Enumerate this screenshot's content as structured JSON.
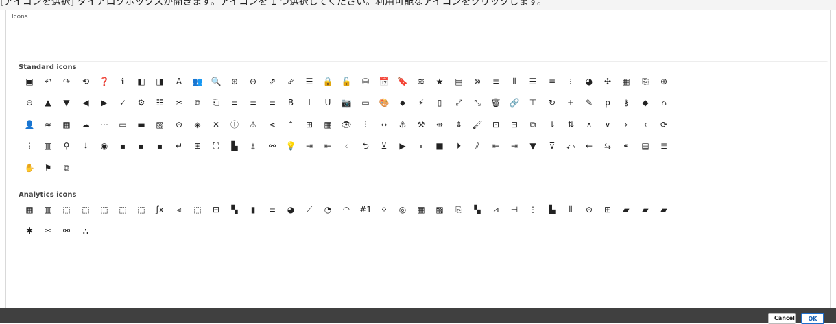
{
  "page": {
    "top_text": "[アイコンを選択] ダイアログボックスが開きます。アイコンを 1 つ選択してください。利用可能なアイコンをクリックします。"
  },
  "dialog": {
    "title": "Icons",
    "sections": [
      {
        "heading": "Standard icons",
        "icons": [
          {
            "name": "image-icon",
            "glyph": "▣"
          },
          {
            "name": "undo-icon",
            "glyph": "↶"
          },
          {
            "name": "redo-icon",
            "glyph": "↷"
          },
          {
            "name": "history-icon",
            "glyph": "⟲"
          },
          {
            "name": "help-icon",
            "glyph": "❓"
          },
          {
            "name": "info-icon",
            "glyph": "ℹ"
          },
          {
            "name": "panel-left-icon",
            "glyph": "◧"
          },
          {
            "name": "panel-right-icon",
            "glyph": "◨"
          },
          {
            "name": "text-icon",
            "glyph": "A"
          },
          {
            "name": "users-icon",
            "glyph": "👥"
          },
          {
            "name": "search-icon",
            "glyph": "🔍"
          },
          {
            "name": "zoom-in-icon",
            "glyph": "⊕"
          },
          {
            "name": "zoom-out-icon",
            "glyph": "⊖"
          },
          {
            "name": "export-icon",
            "glyph": "⇗"
          },
          {
            "name": "import-icon",
            "glyph": "⇙"
          },
          {
            "name": "document-icon",
            "glyph": "☰"
          },
          {
            "name": "lock-icon",
            "glyph": "🔒"
          },
          {
            "name": "unlock-icon",
            "glyph": "🔓"
          },
          {
            "name": "database-icon",
            "glyph": "⛁"
          },
          {
            "name": "calendar-icon",
            "glyph": "📅"
          },
          {
            "name": "bookmark-icon",
            "glyph": "🔖"
          },
          {
            "name": "stack-icon",
            "glyph": "≋"
          },
          {
            "name": "star-icon",
            "glyph": "★"
          },
          {
            "name": "sheet-icon",
            "glyph": "▤"
          },
          {
            "name": "close-circle-icon",
            "glyph": "⊗"
          },
          {
            "name": "menu-icon",
            "glyph": "≡"
          },
          {
            "name": "columns-icon",
            "glyph": "⦀"
          },
          {
            "name": "align-center-icon",
            "glyph": "☰"
          },
          {
            "name": "align-justify-icon",
            "glyph": "≣"
          },
          {
            "name": "bullet-list-icon",
            "glyph": "⁝"
          },
          {
            "name": "pie-chart-icon",
            "glyph": "◕"
          },
          {
            "name": "puzzle-icon",
            "glyph": "✣"
          },
          {
            "name": "table-icon",
            "glyph": "▦"
          },
          {
            "name": "file-export-icon",
            "glyph": "⎘"
          },
          {
            "name": "add-circle-icon",
            "glyph": "⊕"
          },
          {
            "name": "remove-circle-icon",
            "glyph": "⊖"
          },
          {
            "name": "triangle-up-icon",
            "glyph": "▲"
          },
          {
            "name": "triangle-down-icon",
            "glyph": "▼"
          },
          {
            "name": "triangle-left-icon",
            "glyph": "◀"
          },
          {
            "name": "triangle-right-icon",
            "glyph": "▶"
          },
          {
            "name": "tick-icon",
            "glyph": "✓"
          },
          {
            "name": "cog-icon",
            "glyph": "⚙"
          },
          {
            "name": "list-icon",
            "glyph": "☷"
          },
          {
            "name": "cut-icon",
            "glyph": "✂"
          },
          {
            "name": "copy-icon",
            "glyph": "⧉"
          },
          {
            "name": "paste-icon",
            "glyph": "⎗"
          },
          {
            "name": "align-left-icon",
            "glyph": "≡"
          },
          {
            "name": "align-center-text-icon",
            "glyph": "≡"
          },
          {
            "name": "align-right-icon",
            "glyph": "≡"
          },
          {
            "name": "bold-icon",
            "glyph": "B"
          },
          {
            "name": "italic-icon",
            "glyph": "I"
          },
          {
            "name": "underline-icon",
            "glyph": "U"
          },
          {
            "name": "camera-icon",
            "glyph": "📷"
          },
          {
            "name": "presentation-icon",
            "glyph": "▭"
          },
          {
            "name": "palette-icon",
            "glyph": "🎨"
          },
          {
            "name": "shapes-icon",
            "glyph": "⬥"
          },
          {
            "name": "magic-wand-icon",
            "glyph": "⚡"
          },
          {
            "name": "blank-document-icon",
            "glyph": "▯"
          },
          {
            "name": "expand-icon",
            "glyph": "⤢"
          },
          {
            "name": "collapse-icon",
            "glyph": "⤡"
          },
          {
            "name": "trash-icon",
            "glyph": "🗑"
          },
          {
            "name": "link-icon",
            "glyph": "🔗"
          },
          {
            "name": "filter-table-icon",
            "glyph": "⊤"
          },
          {
            "name": "reload-icon",
            "glyph": "↻"
          },
          {
            "name": "plus-icon",
            "glyph": "+"
          },
          {
            "name": "edit-icon",
            "glyph": "✎"
          },
          {
            "name": "lasso-icon",
            "glyph": "ρ"
          },
          {
            "name": "key-icon",
            "glyph": "⚷"
          },
          {
            "name": "cube-icon",
            "glyph": "◆"
          },
          {
            "name": "home-icon",
            "glyph": "⌂"
          },
          {
            "name": "user-icon",
            "glyph": "👤"
          },
          {
            "name": "wave-icon",
            "glyph": "≈"
          },
          {
            "name": "grid-icon",
            "glyph": "▦"
          },
          {
            "name": "cloud-icon",
            "glyph": "☁"
          },
          {
            "name": "more-icon",
            "glyph": "⋯"
          },
          {
            "name": "folder-icon",
            "glyph": "▭"
          },
          {
            "name": "minimize-icon",
            "glyph": "▬"
          },
          {
            "name": "image-frame-icon",
            "glyph": "▧"
          },
          {
            "name": "play-circle-icon",
            "glyph": "⊙"
          },
          {
            "name": "tag-icon",
            "glyph": "◈"
          },
          {
            "name": "close-icon",
            "glyph": "✕"
          },
          {
            "name": "info-circle-icon",
            "glyph": "ⓘ"
          },
          {
            "name": "warning-icon",
            "glyph": "⚠"
          },
          {
            "name": "share-icon",
            "glyph": "⋖"
          },
          {
            "name": "double-chevron-up-icon",
            "glyph": "⌃"
          },
          {
            "name": "object-icon",
            "glyph": "⊞"
          },
          {
            "name": "table-grid-icon",
            "glyph": "▦"
          },
          {
            "name": "view-icon",
            "glyph": "👁"
          },
          {
            "name": "sliders-icon",
            "glyph": "⫶"
          },
          {
            "name": "code-icon",
            "glyph": "‹›"
          },
          {
            "name": "drop-icon",
            "glyph": "⚓"
          },
          {
            "name": "tools-icon",
            "glyph": "⚒"
          },
          {
            "name": "split-icon",
            "glyph": "⇹"
          },
          {
            "name": "sort-icon",
            "glyph": "⇕"
          },
          {
            "name": "paint-icon",
            "glyph": "🖌"
          },
          {
            "name": "screen-icon",
            "glyph": "⊡"
          },
          {
            "name": "box-icon",
            "glyph": "⊟"
          },
          {
            "name": "duplicate-icon",
            "glyph": "⧉"
          },
          {
            "name": "sort-ascending-icon",
            "glyph": "⇂"
          },
          {
            "name": "sort-descending-icon",
            "glyph": "⇅"
          },
          {
            "name": "chevron-up-icon",
            "glyph": "∧"
          },
          {
            "name": "chevron-down-icon",
            "glyph": "∨"
          },
          {
            "name": "chevron-right-icon",
            "glyph": "›"
          },
          {
            "name": "chevron-left-icon",
            "glyph": "‹"
          },
          {
            "name": "sync-icon",
            "glyph": "⟳"
          },
          {
            "name": "drag-handle-icon",
            "glyph": "⁞"
          },
          {
            "name": "layout-icon",
            "glyph": "▥"
          },
          {
            "name": "pivot-icon",
            "glyph": "⚲"
          },
          {
            "name": "download-icon",
            "glyph": "⤓"
          },
          {
            "name": "bot-icon",
            "glyph": "◉"
          },
          {
            "name": "object-small-icon",
            "glyph": "▪"
          },
          {
            "name": "object-medium-icon",
            "glyph": "▪"
          },
          {
            "name": "object-large-icon",
            "glyph": "▪"
          },
          {
            "name": "enter-icon",
            "glyph": "↵"
          },
          {
            "name": "qr-icon",
            "glyph": "⊞"
          },
          {
            "name": "focus-icon",
            "glyph": "⛶"
          },
          {
            "name": "component-icon",
            "glyph": "▙"
          },
          {
            "name": "bell-icon",
            "glyph": "⍋"
          },
          {
            "name": "broken-link-icon",
            "glyph": "⚯"
          },
          {
            "name": "bulb-icon",
            "glyph": "💡"
          },
          {
            "name": "login-icon",
            "glyph": "⇥"
          },
          {
            "name": "logout-icon",
            "glyph": "⇤"
          },
          {
            "name": "back-icon",
            "glyph": "‹"
          },
          {
            "name": "return-icon",
            "glyph": "⮌"
          },
          {
            "name": "save-icon",
            "glyph": "⊻"
          },
          {
            "name": "play-icon",
            "glyph": "▶"
          },
          {
            "name": "pause-icon",
            "glyph": "⏸"
          },
          {
            "name": "stop-icon",
            "glyph": "■"
          },
          {
            "name": "step-icon",
            "glyph": "⏵"
          },
          {
            "name": "slash-icon",
            "glyph": "⫽"
          },
          {
            "name": "insert-left-icon",
            "glyph": "⇤"
          },
          {
            "name": "insert-right-icon",
            "glyph": "⇥"
          },
          {
            "name": "filter-icon",
            "glyph": "▼"
          },
          {
            "name": "clear-filter-icon",
            "glyph": "⊽"
          },
          {
            "name": "select-icon",
            "glyph": "⤺"
          },
          {
            "name": "arrow-left-icon",
            "glyph": "←"
          },
          {
            "name": "swap-icon",
            "glyph": "⇆"
          },
          {
            "name": "tree-icon",
            "glyph": "⚭"
          },
          {
            "name": "form-icon",
            "glyph": "▤"
          },
          {
            "name": "hamburger-icon",
            "glyph": "≣"
          },
          {
            "name": "hand-icon",
            "glyph": "✋"
          },
          {
            "name": "flag-icon",
            "glyph": "⚑"
          },
          {
            "name": "external-link-icon",
            "glyph": "⧉"
          }
        ]
      },
      {
        "heading": "Analytics icons",
        "icons": [
          {
            "name": "kpi-icon",
            "glyph": "▦"
          },
          {
            "name": "bar-kpi-icon",
            "glyph": "▥"
          },
          {
            "name": "clear-selection-icon",
            "glyph": "⬚"
          },
          {
            "name": "select-values-icon",
            "glyph": "⬚"
          },
          {
            "name": "lasso-select-icon",
            "glyph": "⬚"
          },
          {
            "name": "select-back-icon",
            "glyph": "⬚"
          },
          {
            "name": "select-forward-icon",
            "glyph": "⬚"
          },
          {
            "name": "expression-icon",
            "glyph": "ƒx"
          },
          {
            "name": "filter-pane-icon",
            "glyph": "⫷"
          },
          {
            "name": "selections-tool-icon",
            "glyph": "⬚"
          },
          {
            "name": "calculator-icon",
            "glyph": "⊟"
          },
          {
            "name": "combo-chart-icon",
            "glyph": "▚"
          },
          {
            "name": "bar-chart-icon",
            "glyph": "▮"
          },
          {
            "name": "horizontal-bar-icon",
            "glyph": "≡"
          },
          {
            "name": "pie-icon",
            "glyph": "◕"
          },
          {
            "name": "line-chart-icon",
            "glyph": "⟋"
          },
          {
            "name": "gauge-pie-icon",
            "glyph": "◔"
          },
          {
            "name": "gauge-icon",
            "glyph": "◠"
          },
          {
            "name": "number-icon",
            "glyph": "#1"
          },
          {
            "name": "scatter-icon",
            "glyph": "⁘"
          },
          {
            "name": "map-icon",
            "glyph": "◎"
          },
          {
            "name": "data-table-icon",
            "glyph": "▦"
          },
          {
            "name": "pivot-table-icon",
            "glyph": "▩"
          },
          {
            "name": "file-kpi-icon",
            "glyph": "⎘"
          },
          {
            "name": "treemap-icon",
            "glyph": "▚"
          },
          {
            "name": "waterfall-icon",
            "glyph": "⊿"
          },
          {
            "name": "box-plot-icon",
            "glyph": "⊣"
          },
          {
            "name": "distribution-icon",
            "glyph": "⋮"
          },
          {
            "name": "histogram-icon",
            "glyph": "▙"
          },
          {
            "name": "mekko-icon",
            "glyph": "⦀"
          },
          {
            "name": "funnel-chart-icon",
            "glyph": "⊙"
          },
          {
            "name": "org-chart-icon",
            "glyph": "⊞"
          },
          {
            "name": "story-icon",
            "glyph": "▰"
          },
          {
            "name": "story-play-icon",
            "glyph": "▰"
          },
          {
            "name": "story-check-icon",
            "glyph": "▰"
          },
          {
            "name": "debug-icon",
            "glyph": "✱"
          },
          {
            "name": "associations-icon",
            "glyph": "⚯"
          },
          {
            "name": "linked-data-icon",
            "glyph": "⚯"
          },
          {
            "name": "network-icon",
            "glyph": "⛬"
          }
        ]
      }
    ]
  },
  "footer": {
    "cancel_label": "Cancel",
    "ok_label": "OK"
  },
  "colors": {
    "footer_bg": "#404040",
    "ok_border": "#1f6fcc",
    "icon_fill": "#222222"
  }
}
